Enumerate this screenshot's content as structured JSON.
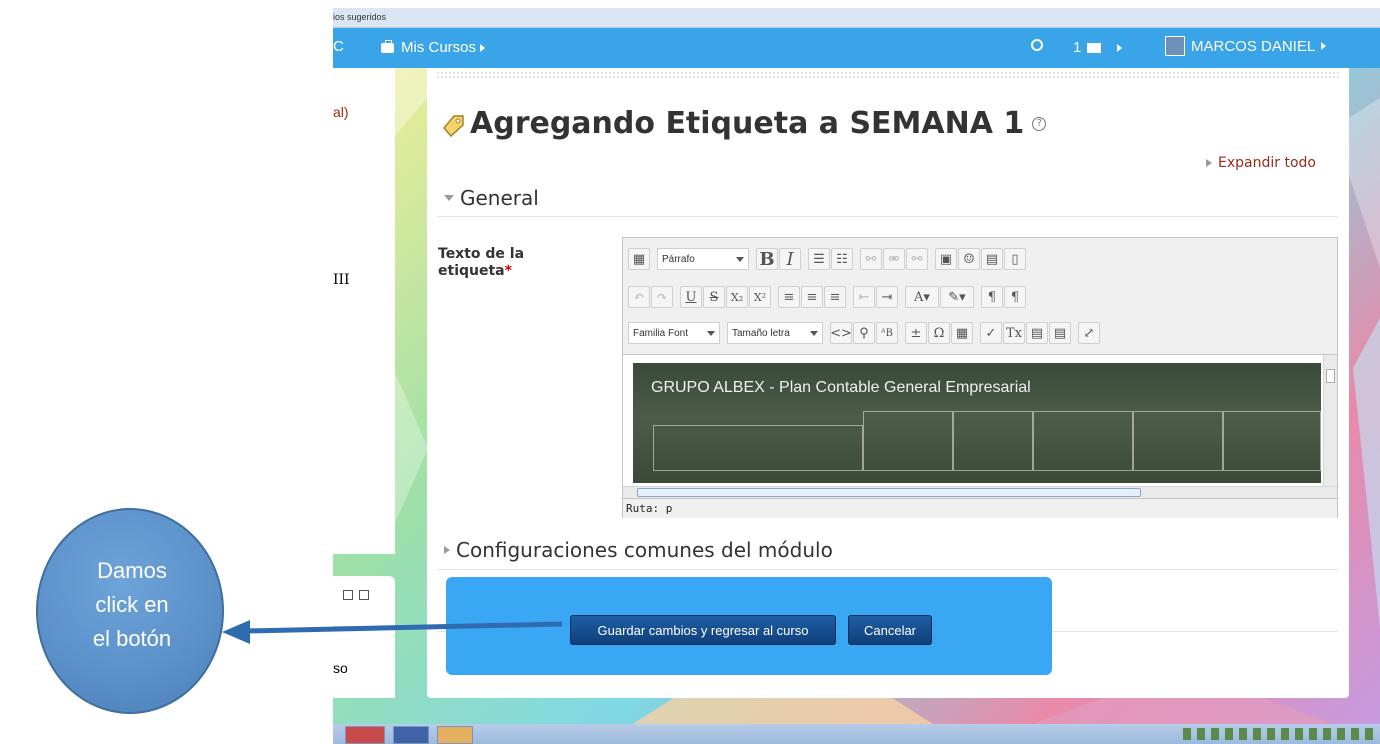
{
  "bookmarks": {
    "text": "ios sugeridos"
  },
  "navbar": {
    "brand": "C",
    "my_courses": "Mis Cursos",
    "messages_count": "1",
    "user_name": "MARCOS DANIEL"
  },
  "sidebar": {
    "frag1": "al)",
    "frag2": "III",
    "frag3": "so"
  },
  "page": {
    "title": "Agregando Etiqueta a SEMANA 1",
    "expand_all": "Expandir todo",
    "section_general": "General",
    "section_common": "Configuraciones comunes del módulo"
  },
  "form": {
    "label_line1": "Texto de la",
    "label_line2": "etiqueta",
    "required_mark": "*"
  },
  "editor": {
    "paragraph_select": "Párrafo",
    "font_family_select": "Familia Font",
    "font_size_select": "Tamaño letra",
    "video_title": "GRUPO ALBEX - Plan Contable General Empresarial",
    "path_label": "Ruta: p"
  },
  "buttons": {
    "save_return": "Guardar cambios y regresar al curso",
    "cancel": "Cancelar"
  },
  "callout": {
    "line1": "Damos",
    "line2": "click en",
    "line3": "el botón"
  },
  "colors": {
    "navbar": "#3aa4e8",
    "popup": "#3aa7f4",
    "primary_button": "#1f5fa5",
    "callout": "#5a8fc8",
    "link": "#9b2a1a"
  }
}
